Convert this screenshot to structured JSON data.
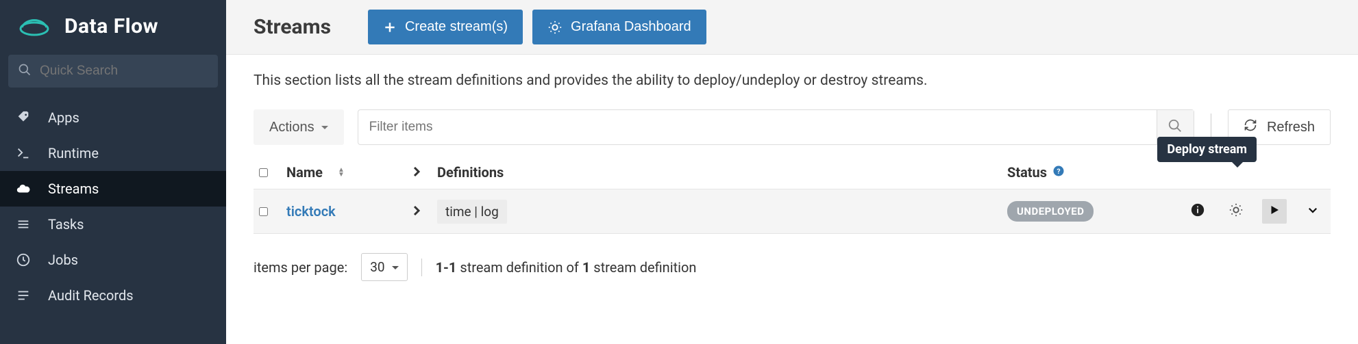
{
  "brand": {
    "title": "Data Flow"
  },
  "search": {
    "placeholder": "Quick Search"
  },
  "nav": {
    "items": [
      {
        "label": "Apps"
      },
      {
        "label": "Runtime"
      },
      {
        "label": "Streams"
      },
      {
        "label": "Tasks"
      },
      {
        "label": "Jobs"
      },
      {
        "label": "Audit Records"
      }
    ],
    "active_index": 2
  },
  "header": {
    "title": "Streams",
    "create_label": "Create stream(s)",
    "grafana_label": "Grafana Dashboard"
  },
  "intro": "This section lists all the stream definitions and provides the ability to deploy/undeploy or destroy streams.",
  "toolbar": {
    "actions_label": "Actions",
    "filter_placeholder": "Filter items",
    "refresh_label": "Refresh"
  },
  "table": {
    "headers": {
      "name": "Name",
      "definitions": "Definitions",
      "status": "Status"
    },
    "rows": [
      {
        "name": "ticktock",
        "definition": "time | log",
        "status": "UNDEPLOYED"
      }
    ]
  },
  "tooltip": {
    "deploy": "Deploy stream"
  },
  "pager": {
    "items_per_page_label": "items per page:",
    "per_page_value": "30",
    "range": "1-1",
    "mid_text": " stream definition of ",
    "total": "1",
    "tail_text": " stream definition"
  }
}
